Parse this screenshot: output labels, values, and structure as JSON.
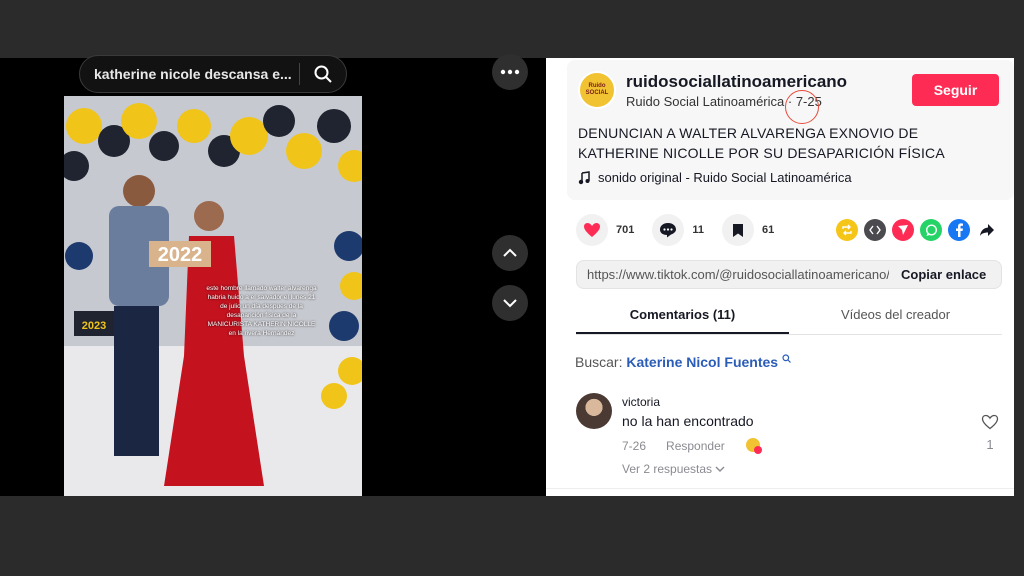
{
  "search": {
    "query": "katherine nicole descansa e..."
  },
  "video": {
    "year_sign": "2022",
    "cap_text": "2023",
    "overlay_text": "este hombre llamado walter alvarenga habria huido a el salvador el lunes 21 de julio un día despues de la desaparición física de la MANICURISTA KATHERIN NICOLLE en la rivera Hernández"
  },
  "post": {
    "avatar_text": "Ruido SOCIAL",
    "username": "ruidosociallatinoamericano",
    "display_name": "Ruido Social Latinoamérica",
    "separator": " · ",
    "date": "7-25",
    "follow_label": "Seguir",
    "description": "DENUNCIAN A WALTER ALVARENGA EXNOVIO DE KATHERINE NICOLLE POR SU DESAPARICIÓN FÍSICA",
    "sound": "sonido original - Ruido Social Latinoamérica"
  },
  "actions": {
    "likes": "701",
    "comments": "11",
    "saves": "61"
  },
  "link": {
    "url": "https://www.tiktok.com/@ruidosociallatinoamericano/video",
    "copy_label": "Copiar enlace"
  },
  "tabs": {
    "comments": "Comentarios (11)",
    "creator_videos": "Vídeos del creador"
  },
  "search_suggestion": {
    "label": "Buscar: ",
    "keyword": "Katerine Nicol Fuentes"
  },
  "comment": {
    "user": "victoria",
    "text": "no la han encontrado",
    "date": "7-26",
    "reply_label": "Responder",
    "like_count": "1",
    "replies_label": "Ver 2 respuestas"
  },
  "colors": {
    "accent": "#fe2c55",
    "link": "#2b5db8",
    "like": "#fe2c55"
  },
  "icons": [
    "search-icon",
    "more-icon",
    "chevron-up-icon",
    "chevron-down-icon",
    "music-note-icon",
    "heart-icon",
    "comment-icon",
    "bookmark-icon",
    "repost-icon",
    "embed-icon",
    "send-icon",
    "whatsapp-icon",
    "facebook-icon",
    "share-arrow-icon"
  ]
}
